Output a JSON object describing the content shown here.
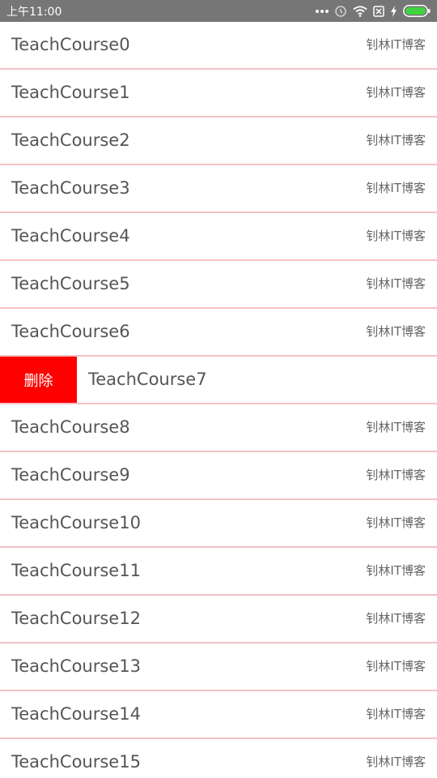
{
  "status_bar": {
    "time": "上午11:00"
  },
  "list": {
    "rows": [
      {
        "title": "TeachCourse0",
        "tag": "钊林IT博客"
      },
      {
        "title": "TeachCourse1",
        "tag": "钊林IT博客"
      },
      {
        "title": "TeachCourse2",
        "tag": "钊林IT博客"
      },
      {
        "title": "TeachCourse3",
        "tag": "钊林IT博客"
      },
      {
        "title": "TeachCourse4",
        "tag": "钊林IT博客"
      },
      {
        "title": "TeachCourse5",
        "tag": "钊林IT博客"
      },
      {
        "title": "TeachCourse6",
        "tag": "钊林IT博客"
      },
      {
        "title": "TeachCourse7",
        "delete_label": "删除"
      },
      {
        "title": "TeachCourse8",
        "tag": "钊林IT博客"
      },
      {
        "title": "TeachCourse9",
        "tag": "钊林IT博客"
      },
      {
        "title": "TeachCourse10",
        "tag": "钊林IT博客"
      },
      {
        "title": "TeachCourse11",
        "tag": "钊林IT博客"
      },
      {
        "title": "TeachCourse12",
        "tag": "钊林IT博客"
      },
      {
        "title": "TeachCourse13",
        "tag": "钊林IT博客"
      },
      {
        "title": "TeachCourse14",
        "tag": "钊林IT博客"
      },
      {
        "title": "TeachCourse15",
        "tag": "钊林IT博客"
      }
    ]
  },
  "colors": {
    "status_bar_bg": "#767676",
    "divider": "#f3c2c8",
    "delete_bg": "#ff0000",
    "battery_fill": "#3fd43f"
  },
  "icons": {
    "status": [
      "more-dots-icon",
      "alarm-icon",
      "wifi-icon",
      "sim-blocked-icon",
      "charging-bolt-icon",
      "battery-icon"
    ]
  }
}
